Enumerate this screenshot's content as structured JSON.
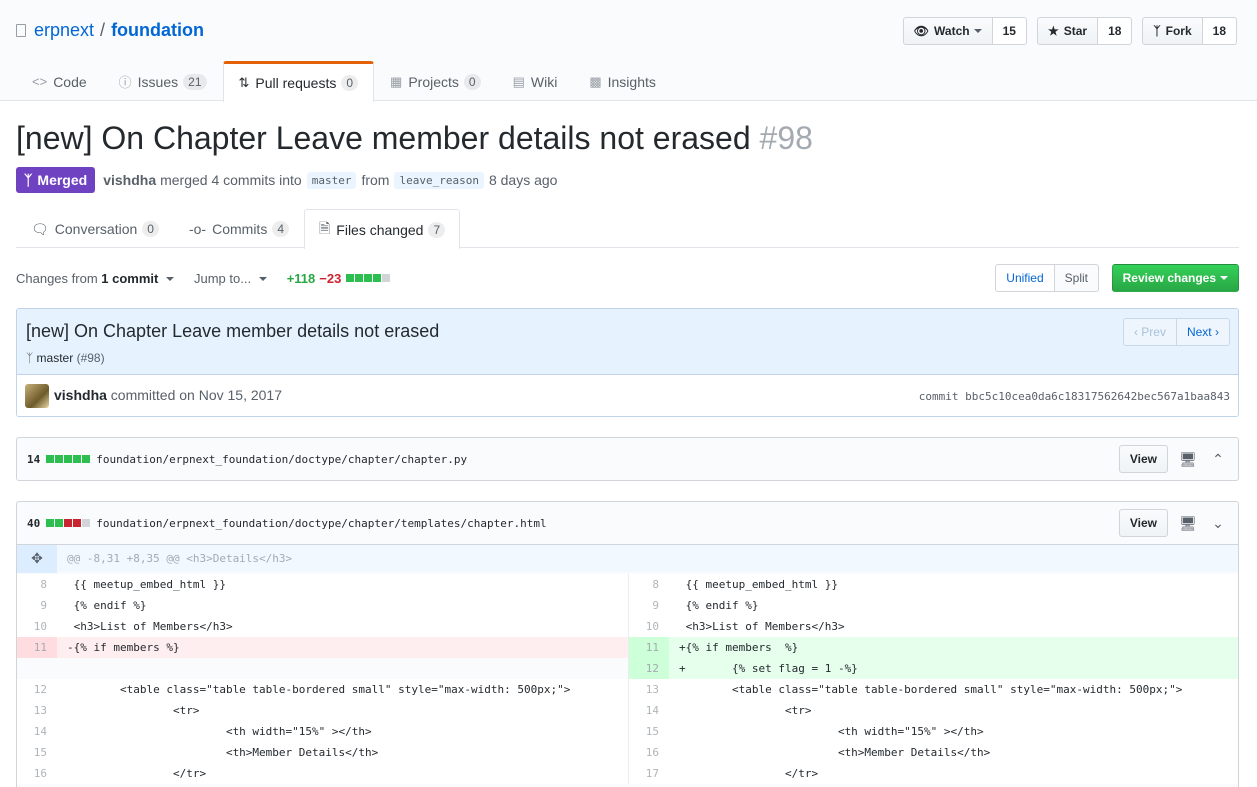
{
  "repo": {
    "owner": "erpnext",
    "separator": "/",
    "name": "foundation"
  },
  "actions": [
    {
      "label": "Watch",
      "icon": "eye-icon",
      "count": "15"
    },
    {
      "label": "Star",
      "icon": "star-icon",
      "count": "18"
    },
    {
      "label": "Fork",
      "icon": "fork-icon",
      "count": "18"
    }
  ],
  "nav": {
    "code": {
      "label": "Code"
    },
    "issues": {
      "label": "Issues",
      "count": "21"
    },
    "pulls": {
      "label": "Pull requests",
      "count": "0"
    },
    "projects": {
      "label": "Projects",
      "count": "0"
    },
    "wiki": {
      "label": "Wiki"
    },
    "insights": {
      "label": "Insights"
    }
  },
  "pr": {
    "title": "[new] On Chapter Leave member details not erased",
    "number": "#98",
    "state": "Merged",
    "author": "vishdha",
    "summary": "merged 4 commits into",
    "base": "master",
    "from": "from",
    "head": "leave_reason",
    "time": "8 days ago"
  },
  "tabs": {
    "conversation": {
      "label": "Conversation",
      "count": "0"
    },
    "commits": {
      "label": "Commits",
      "count": "4"
    },
    "files": {
      "label": "Files changed",
      "count": "7"
    }
  },
  "toolbar": {
    "changes_prefix": "Changes from",
    "changes_value": "1 commit",
    "jump": "Jump to...",
    "additions": "+118",
    "deletions": "−23",
    "diffstat": [
      "g",
      "g",
      "g",
      "g",
      "n"
    ],
    "unified": "Unified",
    "split": "Split",
    "review": "Review changes"
  },
  "commit": {
    "title": "[new] On Chapter Leave member details not erased",
    "branch": "master",
    "branch_ref": "(#98)",
    "author": "vishdha",
    "committed": "committed on Nov 15, 2017",
    "sha": "commit bbc5c10cea0da6c18317562642bec567a1baa843",
    "prev": "Prev",
    "next": "Next"
  },
  "files": [
    {
      "count": "14",
      "path": "foundation/erpnext_foundation/doctype/chapter/chapter.py",
      "view": "View",
      "diffstat": [
        "g",
        "g",
        "g",
        "g",
        "g"
      ]
    },
    {
      "count": "40",
      "path": "foundation/erpnext_foundation/doctype/chapter/templates/chapter.html",
      "view": "View",
      "diffstat": [
        "g",
        "g",
        "r",
        "r",
        "n"
      ]
    }
  ],
  "hunk": "@@ -8,31 +8,35 @@ <h3>Details</h3>",
  "diff": {
    "r0": {
      "ll": "8",
      "lc": " {{ meetup_embed_html }}",
      "rl": "8",
      "rc": " {{ meetup_embed_html }}"
    },
    "r1": {
      "ll": "9",
      "lc": " {% endif %}",
      "rl": "9",
      "rc": " {% endif %}"
    },
    "r2": {
      "ll": "10",
      "lc": " <h3>List of Members</h3>",
      "rl": "10",
      "rc": " <h3>List of Members</h3>"
    },
    "r3": {
      "ll": "11",
      "lc": "-{% if members %}",
      "rl": "11",
      "rc": "+{% if members  %}"
    },
    "r4": {
      "rl": "12",
      "rc": "+       {% set flag = 1 -%}"
    },
    "r5": {
      "ll": "12",
      "lc": "        <table class=\"table table-bordered small\" style=\"max-width: 500px;\">",
      "rl": "13",
      "rc": "        <table class=\"table table-bordered small\" style=\"max-width: 500px;\">"
    },
    "r6": {
      "ll": "13",
      "lc": "                <tr>",
      "rl": "14",
      "rc": "                <tr>"
    },
    "r7": {
      "ll": "14",
      "lc": "                        <th width=\"15%\" ></th>",
      "rl": "15",
      "rc": "                        <th width=\"15%\" ></th>"
    },
    "r8": {
      "ll": "15",
      "lc": "                        <th>Member Details</th>",
      "rl": "16",
      "rc": "                        <th>Member Details</th>"
    },
    "r9": {
      "ll": "16",
      "lc": "                </tr>",
      "rl": "17",
      "rc": "                </tr>"
    }
  }
}
